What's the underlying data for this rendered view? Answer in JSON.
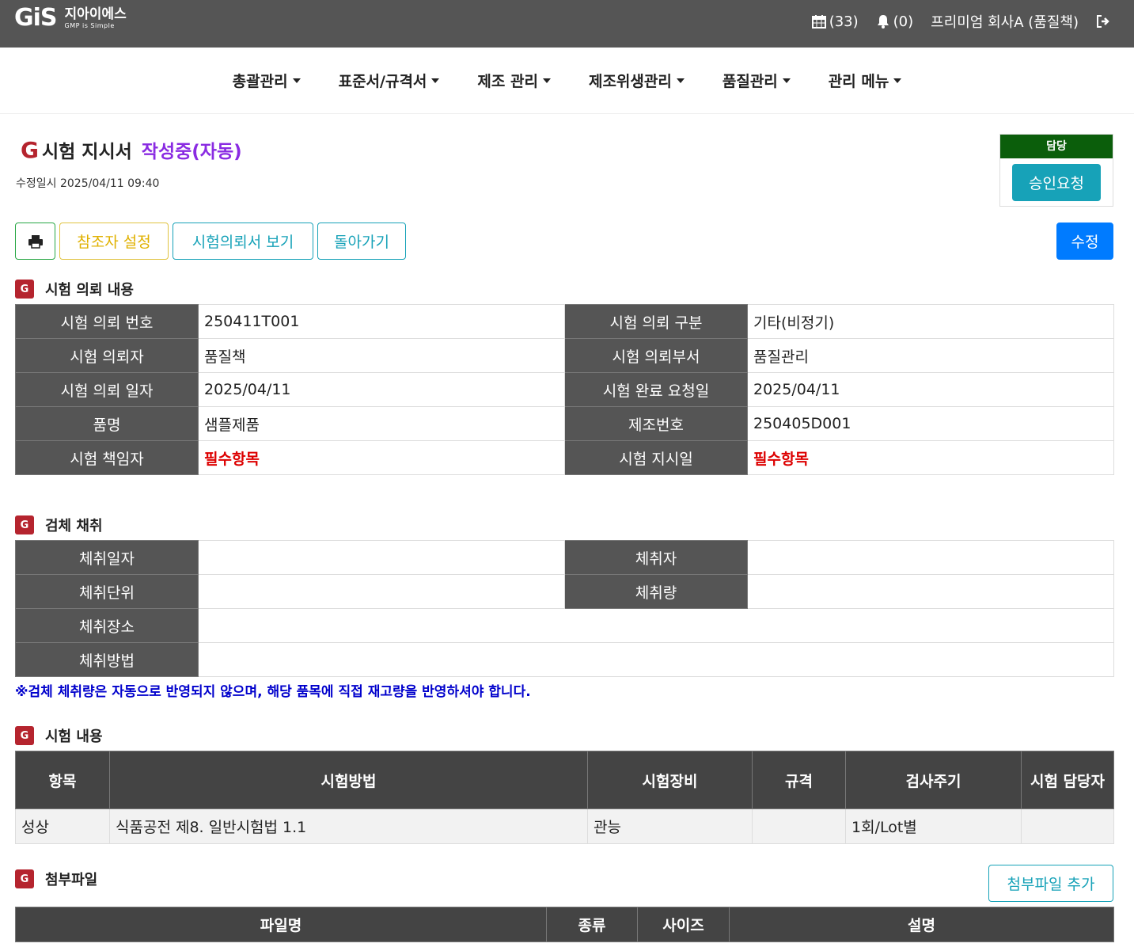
{
  "brand": {
    "mark": "GiS",
    "name": "지아이에스",
    "tagline": "GMP is Simple"
  },
  "topbar": {
    "calendar_count": "(33)",
    "bell_count": "(0)",
    "user": "프리미엄 회사A (품질책)"
  },
  "nav": [
    "총괄관리",
    "표준서/규격서",
    "제조 관리",
    "제조위생관리",
    "품질관리",
    "관리 메뉴"
  ],
  "header": {
    "title": "시험 지시서",
    "status": "작성중(자동)",
    "modified": "수정일시 2025/04/11 09:40",
    "approval_role": "담당",
    "approval_button": "승인요청"
  },
  "buttons": {
    "ref": "참조자 설정",
    "view": "시험의뢰서 보기",
    "back": "돌아가기",
    "edit": "수정"
  },
  "request": {
    "section_title": "시험 의뢰 내용",
    "rows": [
      [
        "시험 의뢰 번호",
        "250411T001",
        "시험 의뢰 구분",
        "기타(비정기)"
      ],
      [
        "시험 의뢰자",
        "품질책",
        "시험 의뢰부서",
        "품질관리"
      ],
      [
        "시험 의뢰 일자",
        "2025/04/11",
        "시험 완료 요청일",
        "2025/04/11"
      ],
      [
        "품명",
        "샘플제품",
        "제조번호",
        "250405D001"
      ],
      [
        "시험 책임자",
        "필수항목",
        "시험 지시일",
        "필수항목"
      ]
    ]
  },
  "sampling": {
    "section_title": "검체 채취",
    "date_label": "체취일자",
    "person_label": "체취자",
    "unit_label": "체취단위",
    "amount_label": "체취량",
    "place_label": "체취장소",
    "method_label": "체취방법",
    "notice": "※검체 체취량은 자동으로 반영되지 않으며, 해당 품목에 직접 재고량을 반영하셔야 합니다."
  },
  "tests": {
    "section_title": "시험 내용",
    "headers": [
      "항목",
      "시험방법",
      "시험장비",
      "규격",
      "검사주기",
      "시험 담당자"
    ],
    "rows": [
      [
        "성상",
        "식품공전 제8. 일반시험법 1.1",
        "관능",
        "",
        "1회/Lot별",
        ""
      ]
    ]
  },
  "attachments": {
    "section_title": "첨부파일",
    "add_button": "첨부파일 추가",
    "headers": [
      "파일명",
      "종류",
      "사이즈",
      "설명"
    ]
  }
}
